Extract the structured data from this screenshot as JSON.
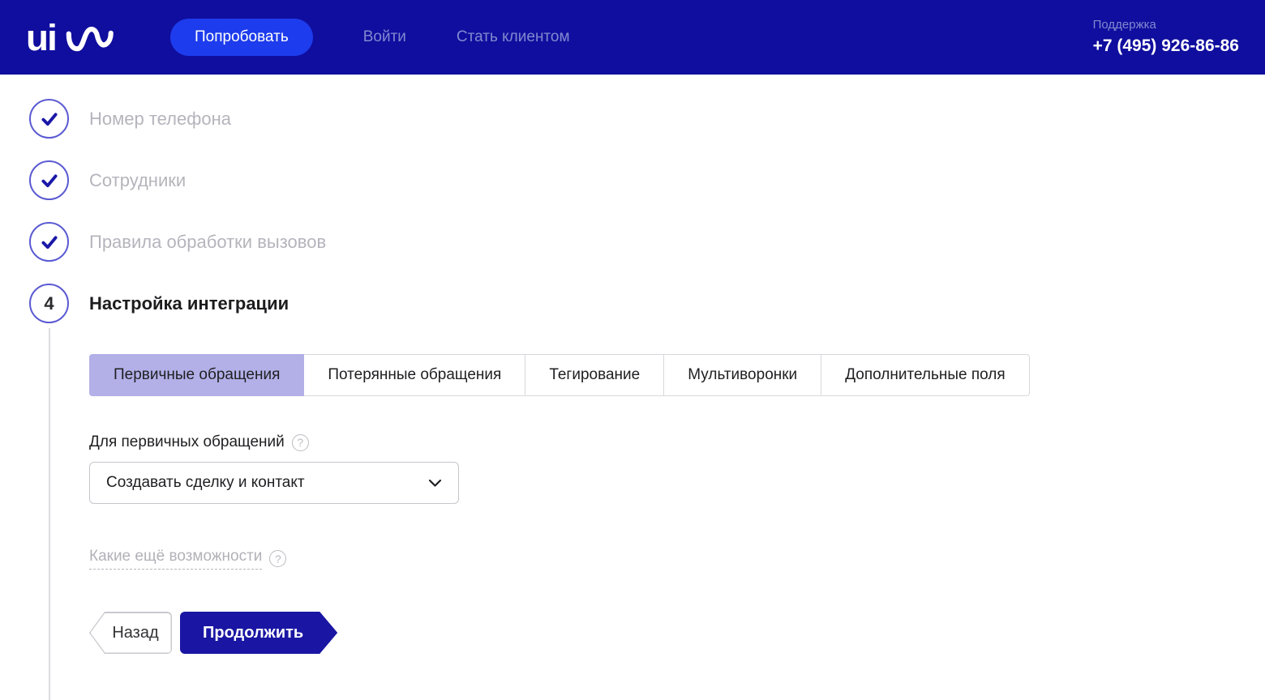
{
  "header": {
    "logo_alt": "uis",
    "nav": [
      {
        "label": "Попробовать"
      },
      {
        "label": "Войти"
      },
      {
        "label": "Стать клиентом"
      }
    ],
    "support": {
      "label": "Поддержка",
      "phone": "+7 (495) 926-86-86"
    }
  },
  "steps": [
    {
      "label": "Номер телефона",
      "state": "done"
    },
    {
      "label": "Сотрудники",
      "state": "done"
    },
    {
      "label": "Правила обработки вызовов",
      "state": "done"
    },
    {
      "number": "4",
      "label": "Настройка интеграции",
      "state": "current"
    }
  ],
  "tabs": [
    {
      "label": "Первичные обращения",
      "active": true
    },
    {
      "label": "Потерянные обращения",
      "active": false
    },
    {
      "label": "Тегирование",
      "active": false
    },
    {
      "label": "Мультиворонки",
      "active": false
    },
    {
      "label": "Дополнительные поля",
      "active": false
    }
  ],
  "form": {
    "field_label": "Для первичных обращений",
    "select_value": "Создавать сделку и контакт",
    "more_link_label": "Какие ещё возможности"
  },
  "actions": {
    "back": "Назад",
    "continue": "Продолжить"
  },
  "icons": {
    "help_glyph": "?"
  },
  "colors": {
    "navbar_bg": "#100e9e",
    "primary_button_bg": "#1d3ced",
    "muted_nav_text": "#8289d0",
    "step_circle_border": "#5a5ad2",
    "check_color": "#1b18a8",
    "muted_label": "#b5b4bc",
    "active_tab_bg": "#b3b0e8",
    "continue_button_bg": "#1a16a3"
  }
}
